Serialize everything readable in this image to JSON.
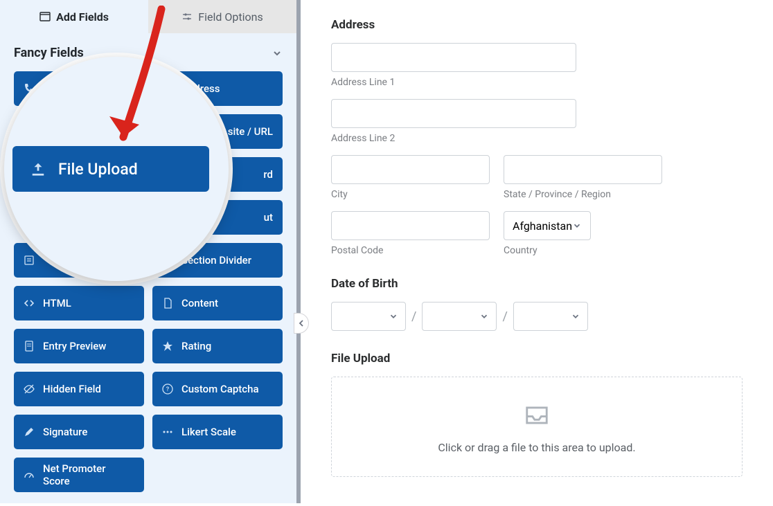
{
  "tabs": {
    "add_fields": "Add Fields",
    "field_options": "Field Options"
  },
  "section_title": "Fancy Fields",
  "fields": {
    "address": "Address",
    "website_url": "site / URL",
    "password": "rd",
    "layout": "ut",
    "section_divider": "Section Divider",
    "html": "HTML",
    "content": "Content",
    "entry_preview": "Entry Preview",
    "rating": "Rating",
    "hidden_field": "Hidden Field",
    "custom_captcha": "Custom Captcha",
    "signature": "Signature",
    "likert_scale": "Likert Scale",
    "net_promoter_score": "Net Promoter Score"
  },
  "magnified": {
    "label": "File Upload"
  },
  "form": {
    "address": {
      "title": "Address",
      "line1": "Address Line 1",
      "line2": "Address Line 2",
      "city": "City",
      "state": "State / Province / Region",
      "postal": "Postal Code",
      "country": "Country",
      "country_value": "Afghanistan"
    },
    "dob": {
      "title": "Date of Birth"
    },
    "upload": {
      "title": "File Upload",
      "hint": "Click or drag a file to this area to upload."
    }
  }
}
